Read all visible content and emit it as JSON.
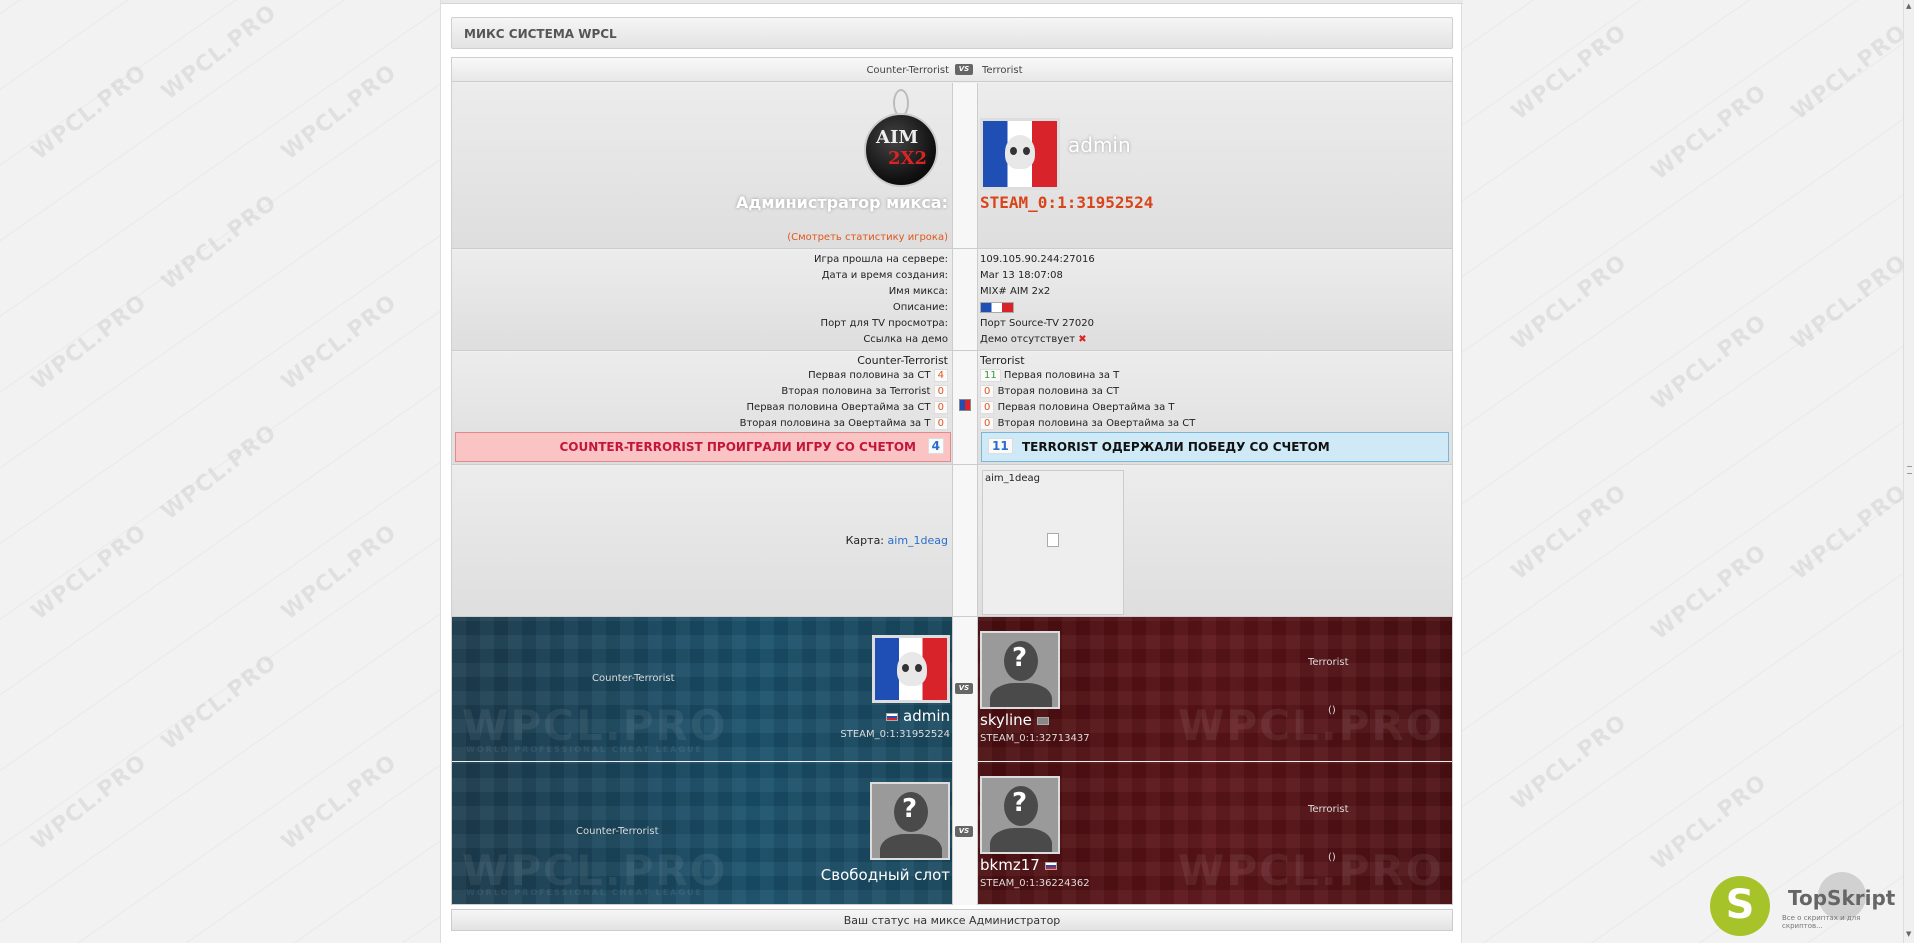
{
  "page": {
    "title": "МИКС СИСТЕМА WPCL",
    "watermark": "WPCL.PRO"
  },
  "header": {
    "ct": "Counter-Terrorist",
    "vs": "VS",
    "t": "Terrorist"
  },
  "admin": {
    "logo_line1": "AIM",
    "logo_line2": "2X2",
    "title": "Администратор микса:",
    "stats_link": "(Смотреть статистику игрока)",
    "name": "admin",
    "steam": "STEAM_0:1:31952524"
  },
  "info": {
    "rows": [
      {
        "label": "Игра прошла на сервере:",
        "value": "109.105.90.244:27016"
      },
      {
        "label": "Дата и время создания:",
        "value": "Mar 13 18:07:08"
      },
      {
        "label": "Имя микса:",
        "value": "MIX# AIM 2x2"
      },
      {
        "label": "Описание:",
        "value": ""
      },
      {
        "label": "Порт для TV просмотра:",
        "value": "Порт Source-TV 27020"
      },
      {
        "label": "Ссылка на демо",
        "value": "Демо отсутствует"
      }
    ]
  },
  "scores": {
    "ct_title": "Counter-Terrorist",
    "t_title": "Terrorist",
    "ct_rows": [
      {
        "label": "Первая половина за CT",
        "value": "4"
      },
      {
        "label": "Вторая половина за Terrorist",
        "value": "0"
      },
      {
        "label": "Первая половина Овертайма за CT",
        "value": "0"
      },
      {
        "label": "Вторая половина за Овертайма за T",
        "value": "0"
      }
    ],
    "t_rows": [
      {
        "label": "Первая половина за T",
        "value": "11"
      },
      {
        "label": "Вторая половина за CT",
        "value": "0"
      },
      {
        "label": "Первая половина Овертайма за T",
        "value": "0"
      },
      {
        "label": "Вторая половина за Овертайма за CT",
        "value": "0"
      }
    ],
    "ct_result": "COUNTER-TERRORIST ПРОИГРАЛИ ИГРУ СО СЧЕТОМ",
    "ct_total": "4",
    "t_result": "TERRORIST ОДЕРЖАЛИ ПОБЕДУ СО СЧЕТОМ",
    "t_total": "11"
  },
  "map": {
    "label": "Карта:",
    "name": "aim_1deag",
    "thumb_caption": "aim_1deag"
  },
  "teams": {
    "ct_label": "Counter-Terrorist",
    "t_label": "Terrorist",
    "t_score": "()",
    "wpcl_logo": "WPCL.PRO",
    "wpcl_sub": "WORLD PROFESSIONAL CHEAT LEAGUE",
    "row1": {
      "ct_player": "admin",
      "ct_steam": "STEAM_0:1:31952524",
      "t_player": "skyline",
      "t_steam": "STEAM_0:1:32713437"
    },
    "row2": {
      "ct_player": "Свободный слот",
      "t_player": "bkmz17",
      "t_steam": "STEAM_0:1:36224362"
    }
  },
  "footer": {
    "status": "Ваш статус на миксе Администратор"
  },
  "badge": {
    "letter": "S",
    "name": "TopSkript",
    "sub": "Все о скриптах и для скриптов..."
  }
}
